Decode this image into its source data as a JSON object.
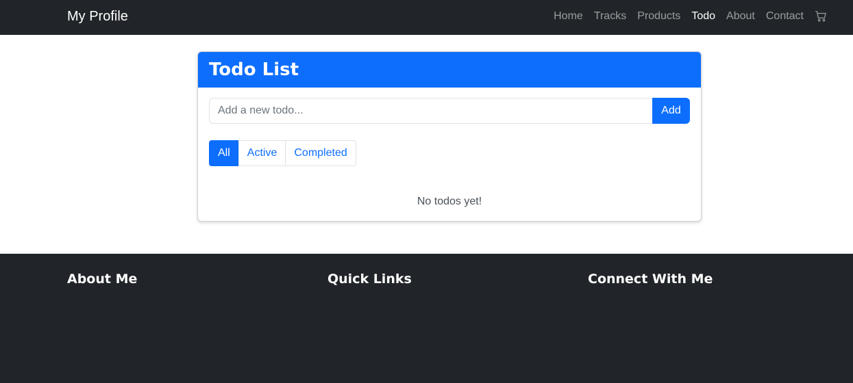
{
  "navbar": {
    "brand": "My Profile",
    "links": [
      {
        "label": "Home",
        "active": false
      },
      {
        "label": "Tracks",
        "active": false
      },
      {
        "label": "Products",
        "active": false
      },
      {
        "label": "Todo",
        "active": true
      },
      {
        "label": "About",
        "active": false
      },
      {
        "label": "Contact",
        "active": false
      }
    ],
    "cart_icon": "cart-icon"
  },
  "todo": {
    "title": "Todo List",
    "input_placeholder": "Add a new todo...",
    "input_value": "",
    "add_label": "Add",
    "filters": [
      {
        "label": "All",
        "active": true
      },
      {
        "label": "Active",
        "active": false
      },
      {
        "label": "Completed",
        "active": false
      }
    ],
    "empty_message": "No todos yet!"
  },
  "footer": {
    "about_heading": "About Me",
    "links_heading": "Quick Links",
    "connect_heading": "Connect With Me"
  },
  "colors": {
    "navbar_bg": "#212529",
    "primary": "#0d6efd",
    "footer_bg": "#212529"
  }
}
